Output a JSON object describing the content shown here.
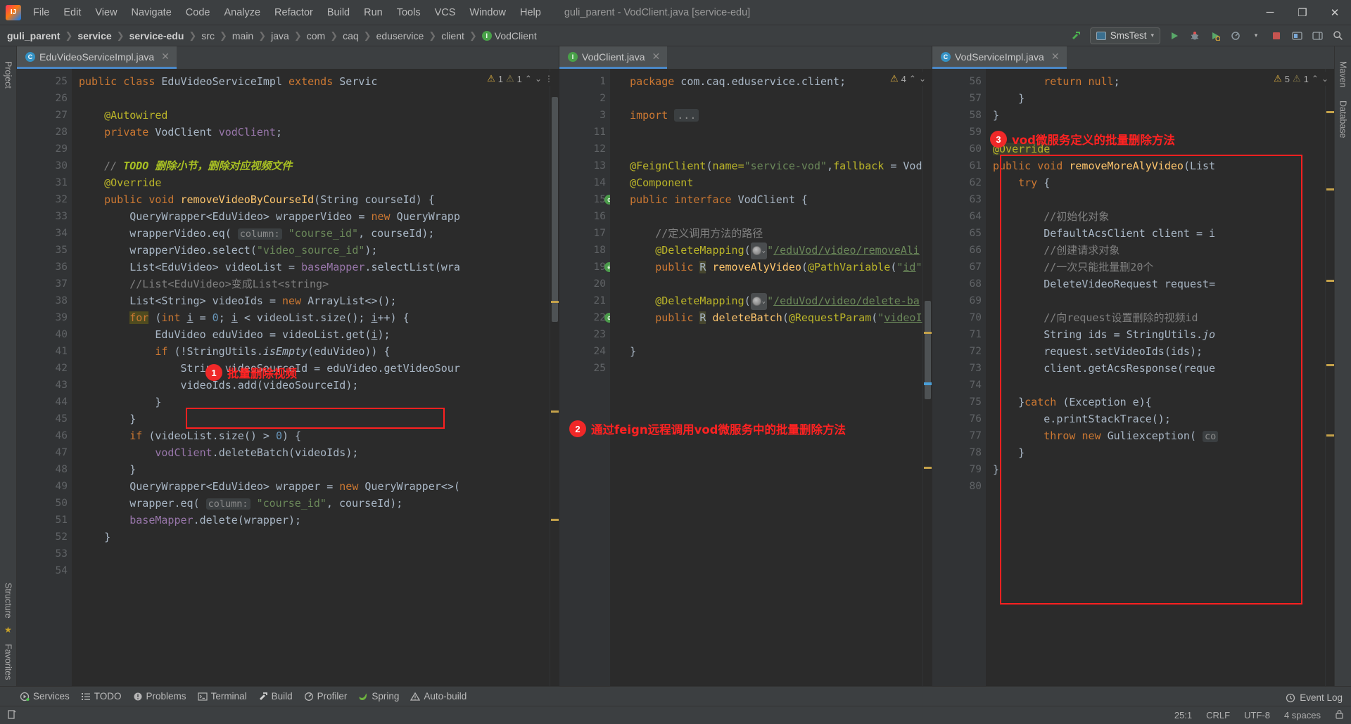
{
  "titlebar": {
    "menus": [
      "File",
      "Edit",
      "View",
      "Navigate",
      "Code",
      "Analyze",
      "Refactor",
      "Build",
      "Run",
      "Tools",
      "VCS",
      "Window",
      "Help"
    ],
    "window_title": "guli_parent - VodClient.java [service-edu]",
    "minimize": "─",
    "maximize": "❐",
    "close": "✕"
  },
  "navbar": {
    "crumbs": [
      "guli_parent",
      "service",
      "service-edu",
      "src",
      "main",
      "java",
      "com",
      "caq",
      "eduservice",
      "client",
      "VodClient"
    ],
    "separator": "❯",
    "run_config": "SmsTest",
    "run_label": "Run",
    "debug_label": "Debug",
    "coverage_label": "Run with Coverage",
    "profile_label": "Profile",
    "stop_label": "Stop",
    "search_label": "Search Everywhere"
  },
  "rail_left": [
    "Project",
    "Structure",
    "Favorites"
  ],
  "rail_right": [
    "Maven",
    "Database"
  ],
  "panes": [
    {
      "tab": {
        "label": "EduVideoServiceImpl.java",
        "icon": "class-icon",
        "icon_letter": "C",
        "close": "✕"
      },
      "inspections": {
        "warn_count": "1",
        "weak_count": "1",
        "up": "⌃",
        "down": "⌄",
        "more": "⋮"
      },
      "first_line": 25,
      "lines": [
        "25",
        "26",
        "27",
        "28",
        "29",
        "30",
        "31",
        "32",
        "33",
        "34",
        "35",
        "36",
        "37",
        "38",
        "39",
        "40",
        "41",
        "42",
        "43",
        "44",
        "45",
        "46",
        "47",
        "48",
        "49",
        "50",
        "51",
        "52",
        "53",
        "54"
      ]
    },
    {
      "tab": {
        "label": "VodClient.java",
        "icon": "interface-icon",
        "icon_letter": "I",
        "close": "✕"
      },
      "inspections": {
        "warn_count": "4",
        "up": "⌃",
        "down": "⌄"
      },
      "lines": [
        "1",
        "2",
        "3",
        "11",
        "12",
        "13",
        "14",
        "15",
        "16",
        "17",
        "18",
        "19",
        "20",
        "21",
        "22",
        "23",
        "24",
        "25"
      ]
    },
    {
      "tab": {
        "label": "VodServiceImpl.java",
        "icon": "class-icon",
        "icon_letter": "C",
        "close": "✕"
      },
      "inspections": {
        "warn_count": "5",
        "weak_count": "1",
        "up": "⌃",
        "down": "⌄"
      },
      "lines": [
        "56",
        "57",
        "58",
        "59",
        "60",
        "61",
        "62",
        "63",
        "64",
        "65",
        "66",
        "67",
        "68",
        "69",
        "70",
        "71",
        "72",
        "73",
        "74",
        "75",
        "76",
        "77",
        "78",
        "79",
        "80"
      ]
    }
  ],
  "annotations": [
    {
      "num": "1",
      "text": "批量删除视频"
    },
    {
      "num": "2",
      "text": "通过feign远程调用vod微服务中的批量删除方法"
    },
    {
      "num": "3",
      "text": "vod微服务定义的批量删除方法"
    }
  ],
  "bottombar": {
    "items": [
      {
        "label": "Services",
        "icon": "services-icon"
      },
      {
        "label": "TODO",
        "icon": "todo-icon"
      },
      {
        "label": "Problems",
        "icon": "problems-icon"
      },
      {
        "label": "Terminal",
        "icon": "terminal-icon"
      },
      {
        "label": "Build",
        "icon": "build-icon"
      },
      {
        "label": "Profiler",
        "icon": "profiler-icon"
      },
      {
        "label": "Spring",
        "icon": "spring-icon"
      },
      {
        "label": "Auto-build",
        "icon": "autobuild-icon"
      }
    ],
    "event_log": "Event Log"
  },
  "statusbar": {
    "caret": "25:1",
    "line_sep": "CRLF",
    "encoding": "UTF-8",
    "indent": "4 spaces",
    "lock": "🔒"
  },
  "colors": {
    "accent": "#4a88c7",
    "annotation_red": "#ff2020",
    "editor_bg": "#2b2b2b",
    "chrome_bg": "#3c3f41",
    "gutter_bg": "#313335"
  },
  "code": {
    "pane1": [
      {
        "n": "25",
        "html": "<span class=\"kw\">public</span> <span class=\"kw\">class</span> <span class=\"cls\">EduVideoServiceImpl</span> <span class=\"kw\">extends</span> <span class=\"cls\">Servic</span>"
      },
      {
        "n": "26",
        "html": ""
      },
      {
        "n": "27",
        "html": "    <span class=\"ann\">@Autowired</span>"
      },
      {
        "n": "28",
        "html": "    <span class=\"kw\">private</span> <span class=\"cls\">VodClient</span> <span class=\"fld\">vodClient</span><span class=\"pln\">;</span>"
      },
      {
        "n": "29",
        "html": ""
      },
      {
        "n": "30",
        "html": "    <span class=\"cmt\">// </span><span class=\"todo\">TODO 删除小节，删除对应视频文件</span>"
      },
      {
        "n": "31",
        "html": "    <span class=\"ann\">@Override</span>"
      },
      {
        "n": "32",
        "html": "    <span class=\"kw\">public</span> <span class=\"kw\">void</span> <span class=\"fn\">removeVideoByCourseId</span><span class=\"pln\">(</span><span class=\"cls\">String</span> courseId<span class=\"pln\">) {</span>"
      },
      {
        "n": "33",
        "html": "        <span class=\"cls\">QueryWrapper</span>&lt;<span class=\"cls\">EduVideo</span>&gt; wrapperVideo <span class=\"pln\">=</span> <span class=\"kw\">new</span> <span class=\"cls\">QueryWrapp</span>"
      },
      {
        "n": "34",
        "html": "        wrapperVideo<span class=\"pln\">.</span>eq<span class=\"pln\">(</span> <span class=\"param-hint\">column:</span> <span class=\"str\">\"course_id\"</span><span class=\"pln\">,</span> courseId<span class=\"pln\">);</span>"
      },
      {
        "n": "35",
        "html": "        wrapperVideo<span class=\"pln\">.</span>select<span class=\"pln\">(</span><span class=\"str\">\"video_source_id\"</span><span class=\"pln\">);</span>"
      },
      {
        "n": "36",
        "html": "        <span class=\"cls\">List</span>&lt;<span class=\"cls\">EduVideo</span>&gt; videoList <span class=\"pln\">=</span> <span class=\"fld\">baseMapper</span><span class=\"pln\">.</span>selectList<span class=\"pln\">(</span>wra"
      },
      {
        "n": "37",
        "html": "        <span class=\"cmt2\">//List&lt;EduVideo&gt;变成List&lt;string&gt;</span>"
      },
      {
        "n": "38",
        "html": "        <span class=\"cls\">List</span>&lt;<span class=\"cls\">String</span>&gt; videoIds <span class=\"pln\">=</span> <span class=\"kw\">new</span> <span class=\"cls\">ArrayList</span>&lt;&gt;<span class=\"pln\">();</span>"
      },
      {
        "n": "39",
        "html": "        <span class=\"hl-for kw\">for</span> <span class=\"pln\">(</span><span class=\"kw\">int</span> <span class=\"uline\">i</span> <span class=\"pln\">=</span> <span class=\"num\">0</span><span class=\"pln\">;</span> <span class=\"uline\">i</span> <span class=\"pln\">&lt;</span> videoList<span class=\"pln\">.</span>size<span class=\"pln\">();</span> <span class=\"uline\">i</span><span class=\"pln\">++) {</span>"
      },
      {
        "n": "40",
        "html": "            <span class=\"cls\">EduVideo</span> eduVideo <span class=\"pln\">=</span> videoList<span class=\"pln\">.</span>get<span class=\"pln\">(</span><span class=\"uline\">i</span><span class=\"pln\">);</span>"
      },
      {
        "n": "41",
        "html": "            <span class=\"kw\">if</span> <span class=\"pln\">(!</span><span class=\"cls\">StringUtils</span><span class=\"pln\">.</span><span class=\"ital\">isEmpty</span><span class=\"pln\">(</span>eduVideo<span class=\"pln\">)) {</span>"
      },
      {
        "n": "42",
        "html": "                <span class=\"cls\">String</span> videoSourceId <span class=\"pln\">=</span> eduVideo<span class=\"pln\">.</span>getVideoSour"
      },
      {
        "n": "43",
        "html": "                videoIds<span class=\"pln\">.</span>add<span class=\"pln\">(</span>videoSourceId<span class=\"pln\">);</span>"
      },
      {
        "n": "44",
        "html": "            <span class=\"pln\">}</span>"
      },
      {
        "n": "45",
        "html": "        <span class=\"pln\">}</span>"
      },
      {
        "n": "46",
        "html": "        <span class=\"kw\">if</span> <span class=\"pln\">(</span>videoList<span class=\"pln\">.</span>size<span class=\"pln\">() &gt;</span> <span class=\"num\">0</span><span class=\"pln\">) {</span>"
      },
      {
        "n": "47",
        "html": "            <span class=\"fld\">vodClient</span><span class=\"pln\">.</span>deleteBatch<span class=\"pln\">(</span>videoIds<span class=\"pln\">);</span>"
      },
      {
        "n": "48",
        "html": "        <span class=\"pln\">}</span>"
      },
      {
        "n": "49",
        "html": "        <span class=\"cls\">QueryWrapper</span>&lt;<span class=\"cls\">EduVideo</span>&gt; wrapper <span class=\"pln\">=</span> <span class=\"kw\">new</span> <span class=\"cls\">QueryWrapper</span>&lt;&gt;<span class=\"pln\">(</span>"
      },
      {
        "n": "50",
        "html": "        wrapper<span class=\"pln\">.</span>eq<span class=\"pln\">(</span> <span class=\"param-hint\">column:</span> <span class=\"str\">\"course_id\"</span><span class=\"pln\">,</span> courseId<span class=\"pln\">);</span>"
      },
      {
        "n": "51",
        "html": "        <span class=\"fld\">baseMapper</span><span class=\"pln\">.</span>delete<span class=\"pln\">(</span>wrapper<span class=\"pln\">);</span>"
      },
      {
        "n": "52",
        "html": "    <span class=\"pln\">}</span>"
      },
      {
        "n": "53",
        "html": ""
      },
      {
        "n": "54",
        "html": ""
      }
    ],
    "pane2": [
      {
        "n": "1",
        "html": "  <span class=\"kw\">package</span> com<span class=\"pln\">.</span>caq<span class=\"pln\">.</span>eduservice<span class=\"pln\">.</span>client<span class=\"pln\">;</span>"
      },
      {
        "n": "2",
        "html": ""
      },
      {
        "n": "3",
        "html": "  <span class=\"kw\">import</span> <span class=\"fold\">...</span>"
      },
      {
        "n": "11",
        "html": ""
      },
      {
        "n": "12",
        "html": ""
      },
      {
        "n": "13",
        "html": "  <span class=\"ann\">@FeignClient</span><span class=\"pln\">(</span><span class=\"ann\">name=</span><span class=\"str\">\"service-vod\"</span><span class=\"pln\">,</span><span class=\"ann\">fallback</span> <span class=\"pln\">=</span> <span class=\"cls\">Vod</span>"
      },
      {
        "n": "14",
        "html": "  <span class=\"ann\">@Component</span>"
      },
      {
        "n": "15",
        "html": "  <span class=\"kw\">public</span> <span class=\"kw\">interface</span> <span class=\"cls\">VodClient</span> <span class=\"pln\">{</span>"
      },
      {
        "n": "16",
        "html": ""
      },
      {
        "n": "17",
        "html": "      <span class=\"cmt2\">//定义调用方法的路径</span>"
      },
      {
        "n": "18",
        "html": "      <span class=\"ann\">@DeleteMapping</span><span class=\"pln\">(</span><span class=\"webico\"><span class=\"globe\"></span><span class=\"caret\">⌄</span></span><span class=\"str\">\"</span><span class=\"str uline\">/eduVod/video/removeAli</span>"
      },
      {
        "n": "19",
        "html": "      <span class=\"kw2\">public</span> <span class=\"hl-R cls\">R</span> <span class=\"fn\">removeAlyVideo</span><span class=\"pln\">(</span><span class=\"ann\">@PathVariable</span><span class=\"pln\">(</span><span class=\"str\">\"</span><span class=\"str uline\">id</span><span class=\"str\">\"</span>"
      },
      {
        "n": "20",
        "html": ""
      },
      {
        "n": "21",
        "html": "      <span class=\"ann\">@DeleteMapping</span><span class=\"pln\">(</span><span class=\"webico\"><span class=\"globe\"></span><span class=\"caret\">⌄</span></span><span class=\"str\">\"</span><span class=\"str uline\">/eduVod/video/delete-ba</span>"
      },
      {
        "n": "22",
        "html": "      <span class=\"kw2\">public</span> <span class=\"hl-R cls\">R</span> <span class=\"fn\">deleteBatch</span><span class=\"pln\">(</span><span class=\"ann\">@RequestParam</span><span class=\"pln\">(</span><span class=\"str\">\"</span><span class=\"str uline\">videoI</span>"
      },
      {
        "n": "23",
        "html": ""
      },
      {
        "n": "24",
        "html": "  <span class=\"pln\">}</span>"
      },
      {
        "n": "25",
        "html": ""
      }
    ],
    "pane3": [
      {
        "n": "56",
        "html": "        <span class=\"kw\">return</span> <span class=\"kw\">null</span><span class=\"pln\">;</span>"
      },
      {
        "n": "57",
        "html": "    <span class=\"pln\">}</span>"
      },
      {
        "n": "58",
        "html": "<span class=\"pln\">}</span>"
      },
      {
        "n": "59",
        "html": ""
      },
      {
        "n": "60",
        "html": "<span class=\"hl-ov ann\">@Override</span>"
      },
      {
        "n": "61",
        "html": "<span class=\"kw\">public</span> <span class=\"kw\">void</span> <span class=\"fn\">removeMoreAlyVideo</span><span class=\"pln\">(</span><span class=\"cls\">List</span>"
      },
      {
        "n": "62",
        "html": "    <span class=\"kw\">try</span> <span class=\"pln\">{</span>"
      },
      {
        "n": "63",
        "html": ""
      },
      {
        "n": "64",
        "html": "        <span class=\"cmt2\">//初始化对象</span>"
      },
      {
        "n": "65",
        "html": "        <span class=\"cls\">DefaultAcsClient</span> client <span class=\"pln\">=</span> i"
      },
      {
        "n": "66",
        "html": "        <span class=\"cmt2\">//创建请求对象</span>"
      },
      {
        "n": "67",
        "html": "        <span class=\"cmt2\">//一次只能批量删20个</span>"
      },
      {
        "n": "68",
        "html": "        <span class=\"cls\">DeleteVideoRequest</span> request<span class=\"pln\">=</span>"
      },
      {
        "n": "69",
        "html": ""
      },
      {
        "n": "70",
        "html": "        <span class=\"cmt2\">//向request设置删除的视频id</span>"
      },
      {
        "n": "71",
        "html": "        <span class=\"cls\">String</span> ids <span class=\"pln\">=</span> <span class=\"cls\">StringUtils</span><span class=\"pln\">.</span><span class=\"ital\">jo</span>"
      },
      {
        "n": "72",
        "html": "        request<span class=\"pln\">.</span>setVideoIds<span class=\"pln\">(</span>ids<span class=\"pln\">);</span>"
      },
      {
        "n": "73",
        "html": "        client<span class=\"pln\">.</span>getAcsResponse<span class=\"pln\">(</span>reque"
      },
      {
        "n": "74",
        "html": ""
      },
      {
        "n": "75",
        "html": "    <span class=\"pln\">}</span><span class=\"kw\">catch</span> <span class=\"pln\">(</span><span class=\"cls\">Exception</span> e<span class=\"pln\">){</span>"
      },
      {
        "n": "76",
        "html": "        e<span class=\"pln\">.</span>printStackTrace<span class=\"pln\">();</span>"
      },
      {
        "n": "77",
        "html": "        <span class=\"kw\">throw</span> <span class=\"kw\">new</span> <span class=\"cls\">Guliexception</span><span class=\"pln\">(</span> <span class=\"param-hint\">co</span>"
      },
      {
        "n": "78",
        "html": "    <span class=\"pln\">}</span>"
      },
      {
        "n": "79",
        "html": "<span class=\"pln\">}</span>"
      },
      {
        "n": "80",
        "html": ""
      }
    ]
  }
}
